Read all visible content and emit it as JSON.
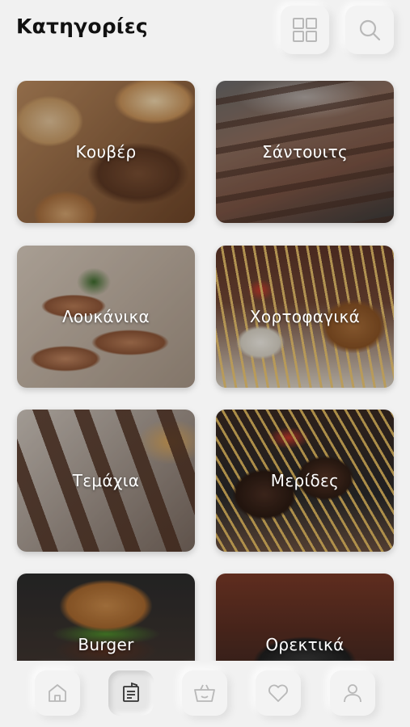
{
  "header": {
    "title": "Κατηγορίες",
    "grid_icon": "grid-view-icon",
    "search_icon": "search-icon"
  },
  "categories": [
    {
      "label": "Κουβέρ",
      "image": "bread"
    },
    {
      "label": "Σάντουιτς",
      "image": "grilled-meat"
    },
    {
      "label": "Λουκάνικα",
      "image": "sausages"
    },
    {
      "label": "Χορτοφαγικά",
      "image": "vegetarian-plate"
    },
    {
      "label": "Τεμάχια",
      "image": "skewers"
    },
    {
      "label": "Μερίδες",
      "image": "burger-patties-plate"
    },
    {
      "label": "Burger",
      "image": "burger"
    },
    {
      "label": "Ορεκτικά",
      "image": "starters"
    }
  ],
  "bottom_nav": {
    "items": [
      {
        "icon": "home-icon",
        "active": false
      },
      {
        "icon": "menu-icon",
        "active": true
      },
      {
        "icon": "basket-icon",
        "active": false
      },
      {
        "icon": "heart-icon",
        "active": false
      },
      {
        "icon": "user-icon",
        "active": false
      }
    ]
  },
  "colors": {
    "background": "#f1f1f1",
    "icon_stroke": "#b8b8b8",
    "active_icon_stroke": "#333333",
    "title": "#111111"
  }
}
